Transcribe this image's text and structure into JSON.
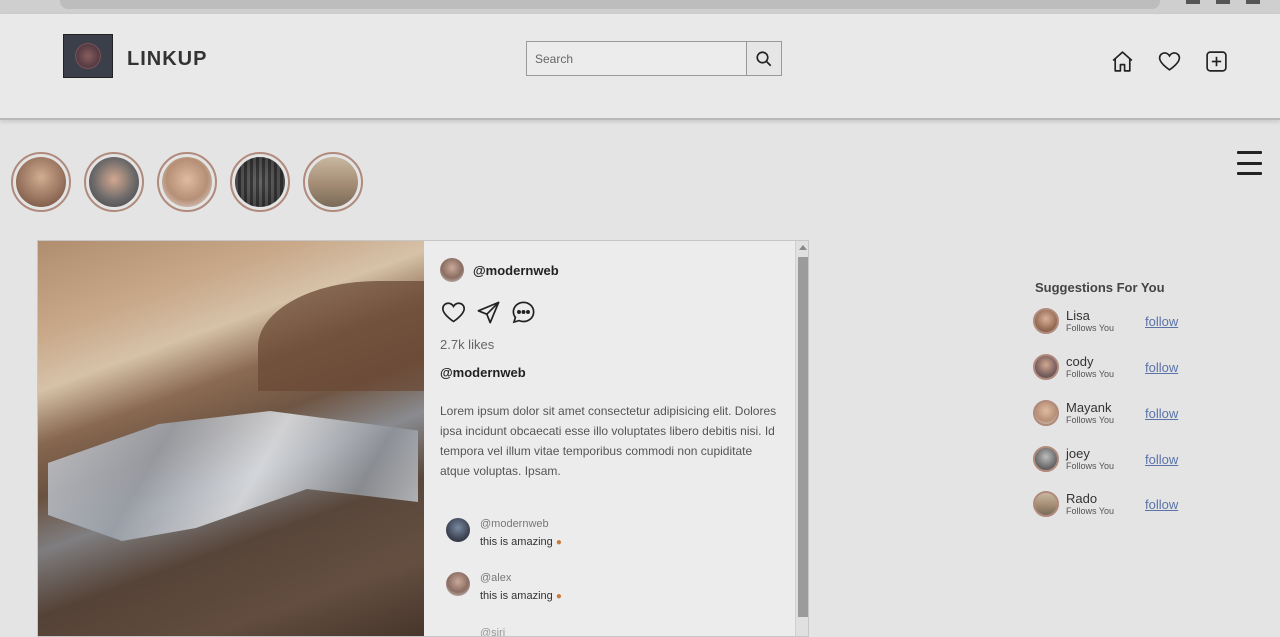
{
  "header": {
    "brand": "LINKUP",
    "search_placeholder": "Search",
    "icons": [
      "home-icon",
      "heart-icon",
      "plus-square-icon"
    ]
  },
  "stories": [
    {
      "name": "story-1",
      "color": "#9a7560"
    },
    {
      "name": "story-2",
      "color": "#6d6a6a"
    },
    {
      "name": "story-3",
      "color": "#b58f76"
    },
    {
      "name": "story-4",
      "color": "#8e8e8e"
    },
    {
      "name": "story-5",
      "color": "#a89078"
    }
  ],
  "post": {
    "author": "@modernweb",
    "likes": "2.7k likes",
    "caption_user": "@modernweb",
    "caption": "Lorem ipsum dolor sit amet consectetur adipisicing elit. Dolores ipsa incidunt obcaecati esse illo voluptates libero debitis nisi. Id tempora vel illum vitae temporibus commodi non cupiditate atque voluptas. Ipsam.",
    "comments": [
      {
        "user": "@modernweb",
        "text": "this is amazing"
      },
      {
        "user": "@alex",
        "text": "this is amazing"
      }
    ],
    "comment_cut": "@siri"
  },
  "suggestions": {
    "title": "Suggestions For You",
    "items": [
      {
        "name": "Lisa",
        "sub": "Follows You",
        "action": "follow"
      },
      {
        "name": "cody",
        "sub": "Follows You",
        "action": "follow"
      },
      {
        "name": "Mayank",
        "sub": "Follows You",
        "action": "follow"
      },
      {
        "name": "joey",
        "sub": "Follows You",
        "action": "follow"
      },
      {
        "name": "Rado",
        "sub": "Follows You",
        "action": "follow"
      }
    ]
  }
}
